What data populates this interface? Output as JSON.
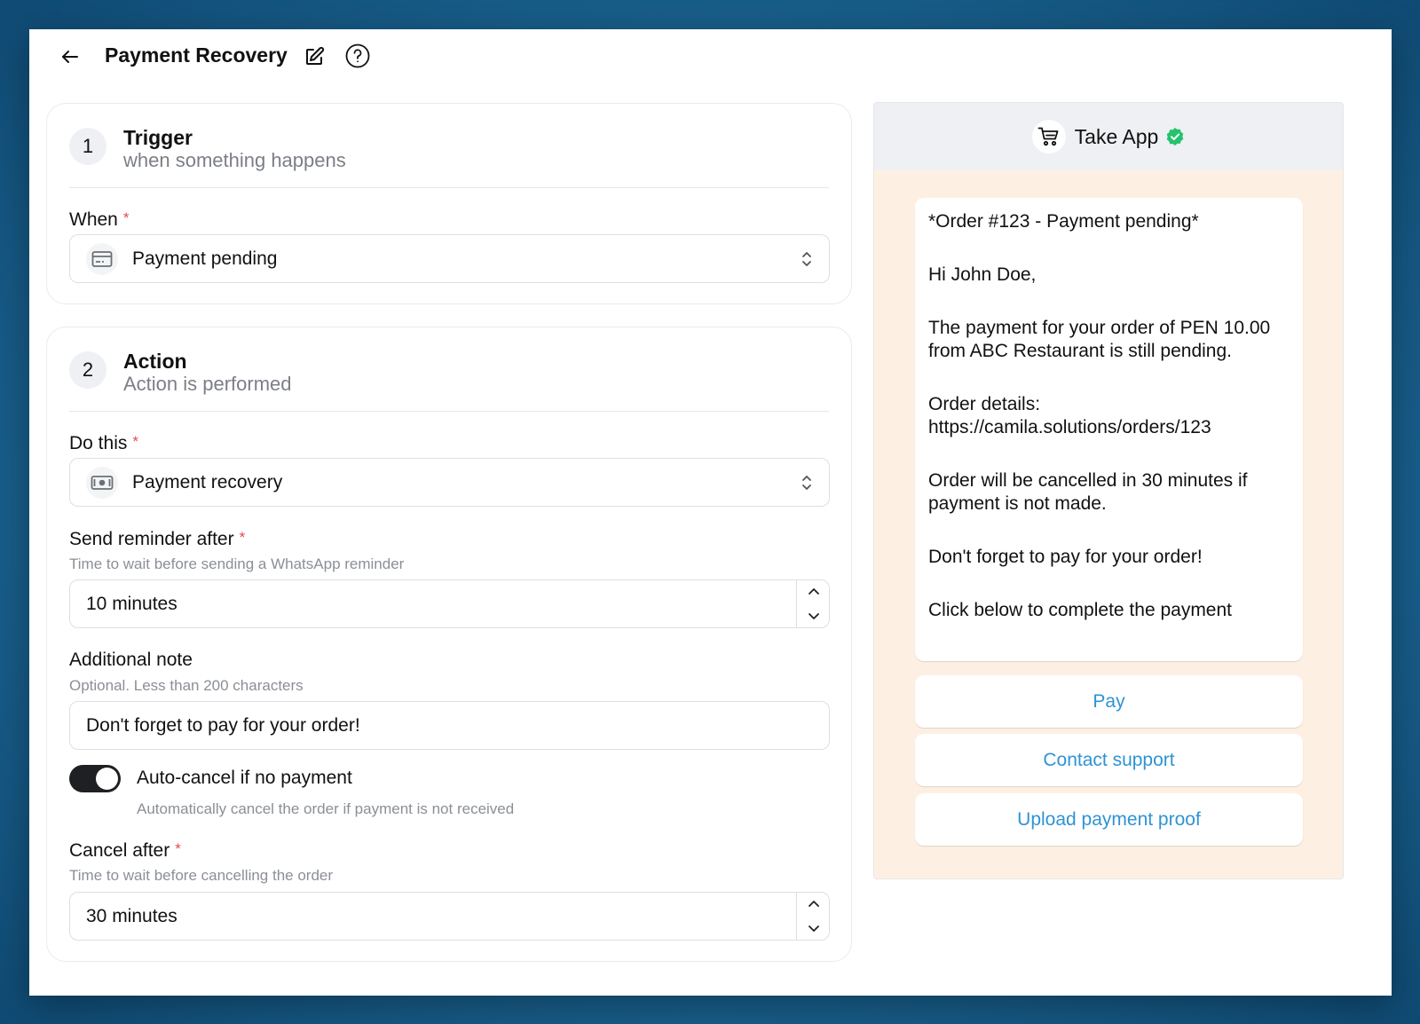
{
  "header": {
    "title": "Payment Recovery"
  },
  "trigger": {
    "step": "1",
    "title": "Trigger",
    "subtitle": "when something happens",
    "when_label": "When",
    "required_mark": "*",
    "when_value": "Payment pending"
  },
  "action": {
    "step": "2",
    "title": "Action",
    "subtitle": "Action is performed",
    "do_label": "Do this",
    "do_value": "Payment recovery",
    "reminder_label": "Send reminder after",
    "reminder_help": "Time to wait before sending a WhatsApp reminder",
    "reminder_value": "10 minutes",
    "note_label": "Additional note",
    "note_help": "Optional. Less than 200 characters",
    "note_value": "Don't forget to pay for your order!",
    "toggle_label": "Auto-cancel if no payment",
    "toggle_help": "Automatically cancel the order if payment is not received",
    "toggle_on": true,
    "cancel_label": "Cancel after",
    "cancel_help": "Time to wait before cancelling the order",
    "cancel_value": "30 minutes"
  },
  "preview": {
    "app_name": "Take App",
    "message": [
      "*Order #123 - Payment pending*",
      "Hi John Doe,",
      "The payment for your order of PEN 10.00 from ABC Restaurant is still pending.",
      "Order details: https://camila.solutions/orders/123",
      "Order will be cancelled in 30 minutes if payment is not made.",
      "Don't forget to pay for your order!",
      "Click below to complete the payment"
    ],
    "buttons": [
      "Pay",
      "Contact support",
      "Upload payment proof"
    ]
  },
  "colors": {
    "accent_link": "#2f93d4",
    "required": "#e5484d",
    "verified": "#25c26e",
    "preview_bg": "#fdf0e3"
  }
}
